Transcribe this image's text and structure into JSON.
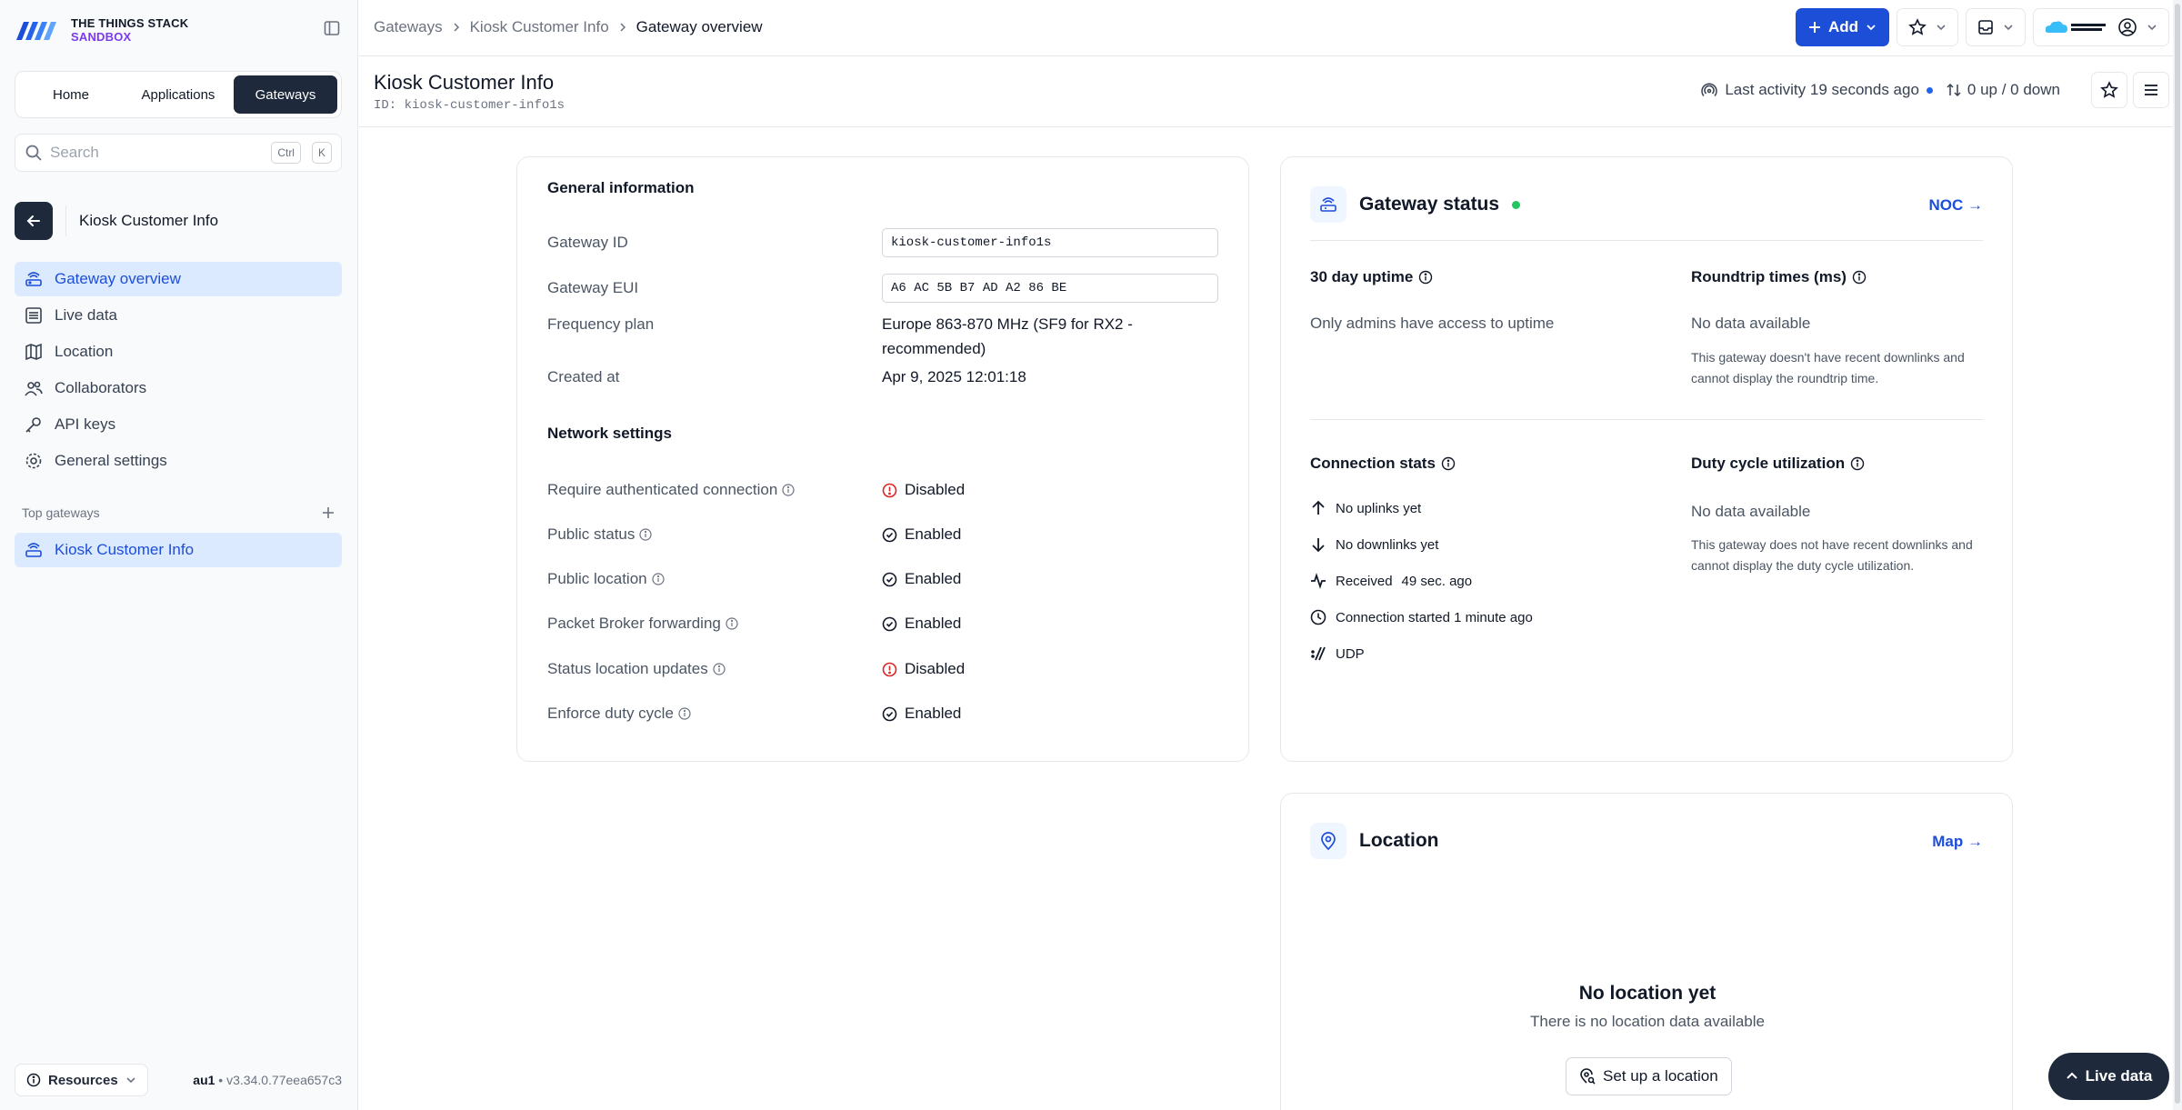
{
  "logo": {
    "line1": "THE THINGS STACK",
    "line2": "SANDBOX"
  },
  "nav_tabs": [
    {
      "label": "Home"
    },
    {
      "label": "Applications"
    },
    {
      "label": "Gateways"
    }
  ],
  "search": {
    "placeholder": "Search",
    "key1": "Ctrl",
    "key2": "K"
  },
  "context": {
    "title": "Kiosk Customer Info"
  },
  "sidebar": {
    "items": [
      {
        "label": "Gateway overview",
        "icon": "gateway-icon"
      },
      {
        "label": "Live data",
        "icon": "list-icon"
      },
      {
        "label": "Location",
        "icon": "map-icon"
      },
      {
        "label": "Collaborators",
        "icon": "users-icon"
      },
      {
        "label": "API keys",
        "icon": "key-icon"
      },
      {
        "label": "General settings",
        "icon": "gear-icon"
      }
    ],
    "top_gateways_label": "Top gateways",
    "top_gateways": [
      {
        "label": "Kiosk Customer Info"
      }
    ]
  },
  "footer": {
    "resources": "Resources",
    "region": "au1",
    "version": "v3.34.0.77eea657c3"
  },
  "breadcrumb": [
    "Gateways",
    "Kiosk Customer Info",
    "Gateway overview"
  ],
  "header": {
    "add_label": "Add"
  },
  "page": {
    "title": "Kiosk Customer Info",
    "id_label": "ID:",
    "id_value": "kiosk-customer-info1s",
    "last_activity": "Last activity 19 seconds ago",
    "traffic": "0 up / 0 down"
  },
  "general": {
    "title": "General information",
    "gateway_id_label": "Gateway ID",
    "gateway_id": "kiosk-customer-info1s",
    "gateway_eui_label": "Gateway EUI",
    "gateway_eui": "A6 AC 5B B7 AD A2 86 BE",
    "frequency_plan_label": "Frequency plan",
    "frequency_plan_1": "Europe 863-870 MHz (SF9 for RX2 -",
    "frequency_plan_2": "recommended)",
    "created_at_label": "Created at",
    "created_at": "Apr 9, 2025 12:01:18"
  },
  "network": {
    "title": "Network settings",
    "rows": [
      {
        "label": "Require authenticated connection",
        "value": "Disabled",
        "status": "disabled"
      },
      {
        "label": "Public status",
        "value": "Enabled",
        "status": "enabled"
      },
      {
        "label": "Public location",
        "value": "Enabled",
        "status": "enabled"
      },
      {
        "label": "Packet Broker forwarding",
        "value": "Enabled",
        "status": "enabled"
      },
      {
        "label": "Status location updates",
        "value": "Disabled",
        "status": "disabled"
      },
      {
        "label": "Enforce duty cycle",
        "value": "Enabled",
        "status": "enabled"
      }
    ]
  },
  "status": {
    "title": "Gateway status",
    "noc_link": "NOC →",
    "uptime_title": "30 day uptime",
    "uptime_text": "Only admins have access to uptime",
    "roundtrip_title": "Roundtrip times (ms)",
    "roundtrip_value": "No data available",
    "roundtrip_note": "This gateway doesn't have recent downlinks and cannot display the roundtrip time.",
    "conn_title": "Connection stats",
    "conn_uplinks": "No uplinks yet",
    "conn_downlinks": "No downlinks yet",
    "conn_received_label": "Received",
    "conn_received_value": "49 sec. ago",
    "conn_started": "Connection started 1 minute ago",
    "conn_protocol": "UDP",
    "duty_title": "Duty cycle utilization",
    "duty_value": "No data available",
    "duty_note": "This gateway does not have recent downlinks and cannot display the duty cycle utilization."
  },
  "location": {
    "title": "Location",
    "map_link": "Map →",
    "empty_title": "No location yet",
    "empty_text": "There is no location data available",
    "setup_button": "Set up a location"
  },
  "live_data_button": "Live data",
  "colors": {
    "accent": "#1d4ed8",
    "dark": "#1e293b",
    "danger": "#dc2626",
    "success": "#22c55e"
  }
}
